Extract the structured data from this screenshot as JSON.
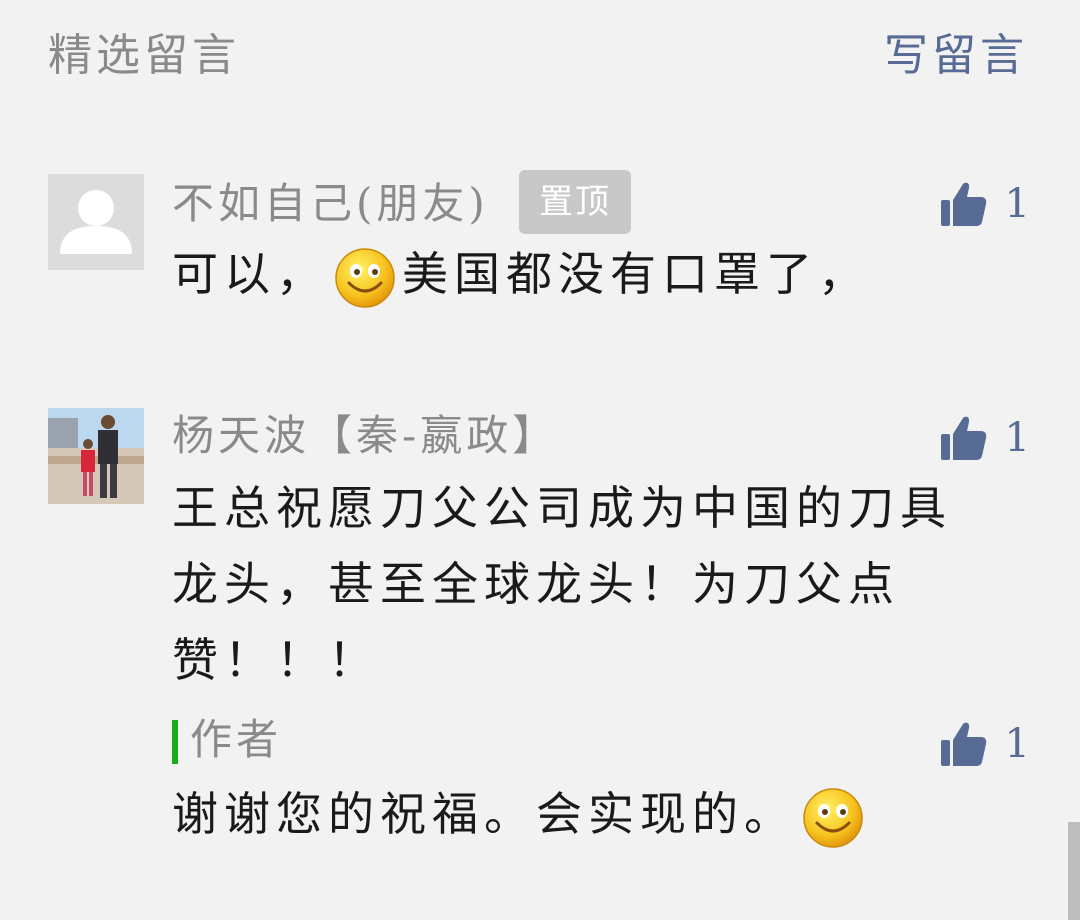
{
  "header": {
    "title": "精选留言",
    "write_label": "写留言"
  },
  "colors": {
    "background": "#f2f2f2",
    "link_blue": "#576b95",
    "author_green": "#1aad19",
    "muted_text": "#8a8a8a"
  },
  "comments": [
    {
      "nickname": "不如自己(朋友)",
      "pinned_label": "置顶",
      "likes": "1",
      "content_before": "可以，",
      "emoji": "smile-emoji",
      "content_after": "美国都没有口罩了，"
    },
    {
      "nickname": "杨天波【秦-嬴政】",
      "likes": "1",
      "content": "王总祝愿刀父公司成为中国的刀具龙头，甚至全球龙头！为刀父点赞！！！",
      "reply": {
        "author_label": "作者",
        "likes": "1",
        "content": "谢谢您的祝福。会实现的。",
        "emoji": "smile-emoji"
      }
    }
  ]
}
